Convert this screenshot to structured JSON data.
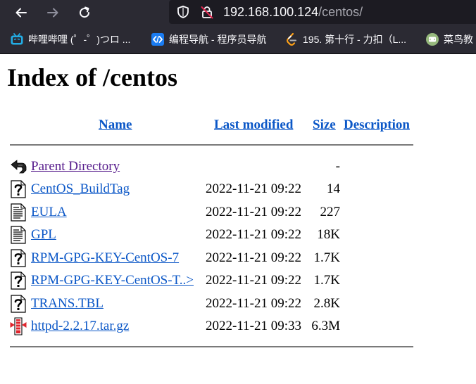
{
  "browser": {
    "url_host": "192.168.100.124",
    "url_path": "/centos/",
    "bookmarks": [
      {
        "label": "哔哩哔哩 (゜-゜)つロ ...",
        "icon": "bilibili-icon"
      },
      {
        "label": "编程导航 - 程序员导航",
        "icon": "code-nav-icon"
      },
      {
        "label": "195. 第十行 - 力扣（L...",
        "icon": "leetcode-icon"
      },
      {
        "label": "菜鸟教",
        "icon": "runoob-icon"
      }
    ],
    "colors": {
      "chrome": "#2b2a33",
      "urlbar": "#1c1b22",
      "link": "#0b57c7",
      "visited": "#551a8b"
    }
  },
  "page": {
    "title": "Index of /centos",
    "columns": {
      "name": "Name",
      "modified": "Last modified",
      "size": "Size",
      "description": "Description"
    },
    "rows": [
      {
        "name": "Parent Directory",
        "modified": "",
        "size": "-",
        "icon": "back-folder-icon"
      },
      {
        "name": "CentOS_BuildTag",
        "modified": "2022-11-21 09:22",
        "size": "14",
        "icon": "unknown-file-icon"
      },
      {
        "name": "EULA",
        "modified": "2022-11-21 09:22",
        "size": "227",
        "icon": "text-file-icon"
      },
      {
        "name": "GPL",
        "modified": "2022-11-21 09:22",
        "size": "18K",
        "icon": "text-file-icon"
      },
      {
        "name": "RPM-GPG-KEY-CentOS-7",
        "modified": "2022-11-21 09:22",
        "size": "1.7K",
        "icon": "unknown-file-icon"
      },
      {
        "name": "RPM-GPG-KEY-CentOS-T..>",
        "modified": "2022-11-21 09:22",
        "size": "1.7K",
        "icon": "unknown-file-icon"
      },
      {
        "name": "TRANS.TBL",
        "modified": "2022-11-21 09:22",
        "size": "2.8K",
        "icon": "unknown-file-icon"
      },
      {
        "name": "httpd-2.2.17.tar.gz",
        "modified": "2022-11-21 09:33",
        "size": "6.3M",
        "icon": "compressed-file-icon"
      }
    ]
  }
}
